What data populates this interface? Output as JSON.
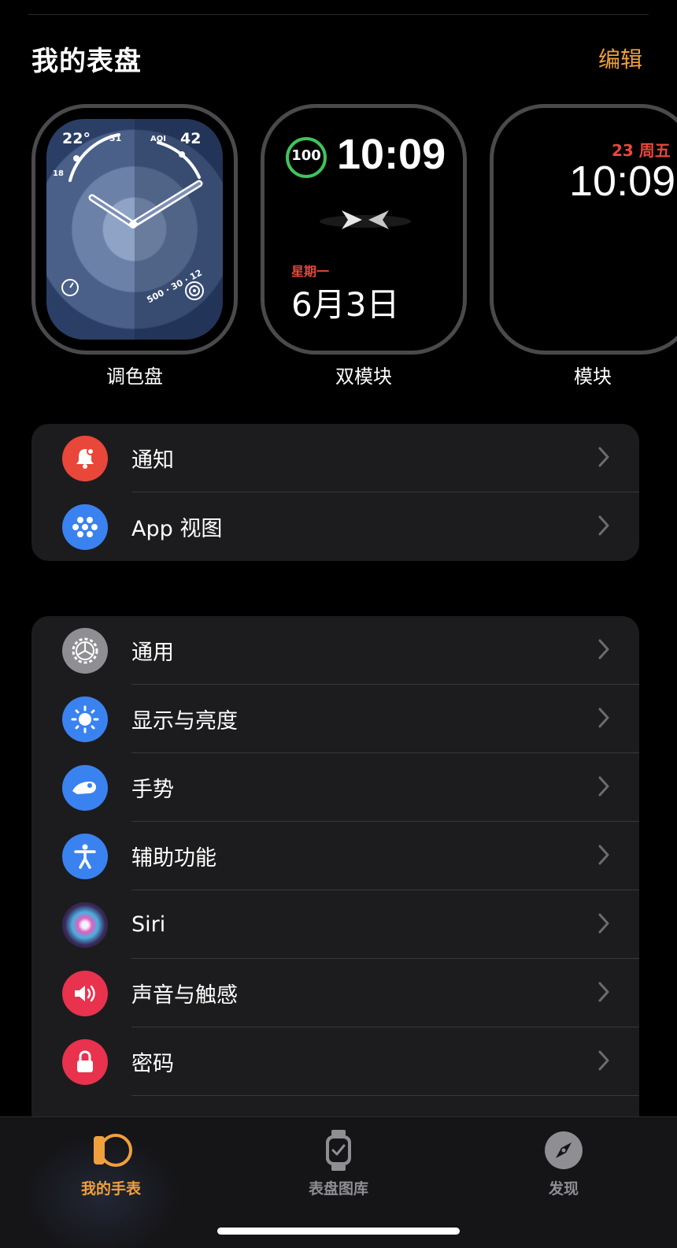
{
  "header": {
    "title": "我的表盘",
    "edit_label": "编辑"
  },
  "watch_faces": [
    {
      "name": "调色盘",
      "complications": {
        "temp": "22°",
        "temp_small": "31",
        "temp_low": "18",
        "aqi_label": "AQI",
        "aqi_value": "42",
        "activity": "500 · 30 · 12"
      }
    },
    {
      "name": "双模块",
      "battery": "100",
      "time": "10:09",
      "weekday": "星期一",
      "date": "6月3日"
    },
    {
      "name": "模块",
      "date": "23 周五",
      "time": "10:09"
    }
  ],
  "group1": [
    {
      "label": "通知",
      "icon": "bell-icon",
      "color": "#e8473a"
    },
    {
      "label": "App 视图",
      "icon": "app-grid-icon",
      "color": "#3a82f0"
    }
  ],
  "group2": [
    {
      "label": "通用",
      "icon": "gear-icon",
      "color": "#8e8e93"
    },
    {
      "label": "显示与亮度",
      "icon": "sun-icon",
      "color": "#3a82f0"
    },
    {
      "label": "手势",
      "icon": "hand-gesture-icon",
      "color": "#3a82f0"
    },
    {
      "label": "辅助功能",
      "icon": "accessibility-icon",
      "color": "#3a82f0"
    },
    {
      "label": "Siri",
      "icon": "siri-icon",
      "color": "#4a2a6a"
    },
    {
      "label": "声音与触感",
      "icon": "speaker-icon",
      "color": "#e8324e"
    },
    {
      "label": "密码",
      "icon": "lock-icon",
      "color": "#e8324e"
    }
  ],
  "tabbar": {
    "tabs": [
      {
        "label": "我的手表",
        "icon": "my-watch-icon",
        "active": true
      },
      {
        "label": "表盘图库",
        "icon": "face-gallery-icon",
        "active": false
      },
      {
        "label": "发现",
        "icon": "compass-icon",
        "active": false
      }
    ],
    "active_color": "#f0a03c",
    "inactive_color": "#8e8e93"
  }
}
